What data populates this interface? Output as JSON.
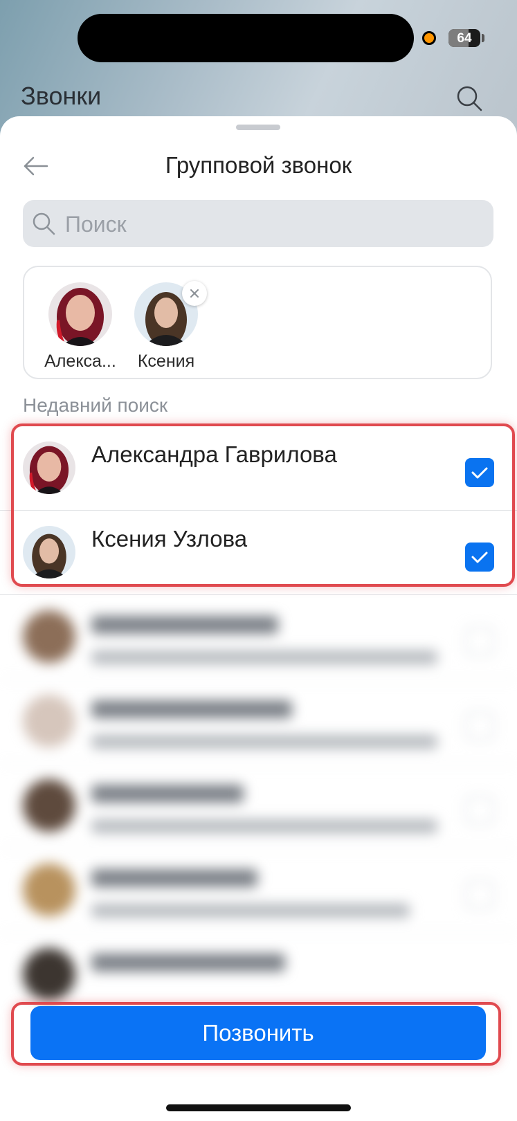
{
  "status_bar": {
    "battery": "64",
    "battery_level": 0.64,
    "indicator_color": "#ff9500"
  },
  "background": {
    "title": "Звонки"
  },
  "sheet": {
    "title": "Групповой звонок",
    "search_placeholder": "Поиск",
    "selected": [
      {
        "label": "Алекса...",
        "removable": false
      },
      {
        "label": "Ксения",
        "removable": true
      }
    ],
    "recent_header": "Недавний поиск",
    "contacts": [
      {
        "name": "Александра Гаврилова",
        "checked": true
      },
      {
        "name": "Ксения Узлова",
        "checked": true
      }
    ],
    "call_button": "Позвонить"
  },
  "colors": {
    "accent": "#0a73f5",
    "highlight": "#e04a4f"
  }
}
